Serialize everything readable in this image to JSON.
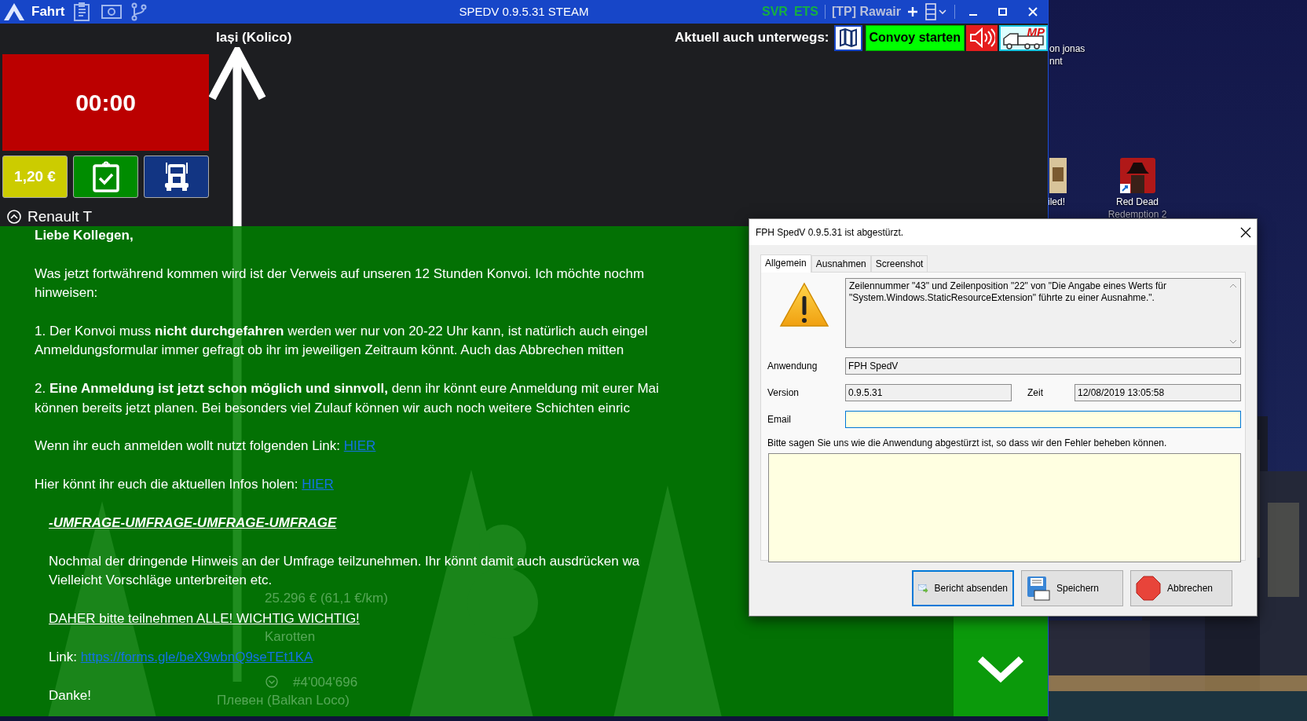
{
  "app": {
    "menu_label": "Fahrt",
    "title": "SPEDV 0.9.5.31 STEAM",
    "games": [
      {
        "text": "SVR",
        "active": true
      },
      {
        "text": "ETS",
        "active": true
      }
    ],
    "profile": "[TP] Rawair"
  },
  "route": {
    "from": "Iași (Kolico)",
    "to": "Плевен (Balkan Loco)"
  },
  "convoy": {
    "label": "Aktuell auch unterwegs:",
    "button": "Convoy starten",
    "mp_badge": "MP"
  },
  "timer": "00:00",
  "price": "1,20 €",
  "truck": "Renault T",
  "job": {
    "income": "25.296 € (61,1 €/km)",
    "cargo": "Karotten",
    "number": "#4'004'696"
  },
  "message": {
    "paragraphs": [
      {
        "kind": "greeting",
        "indented": false,
        "lines": [
          {
            "text": "Liebe Kollegen,"
          }
        ]
      },
      {
        "kind": "text",
        "indented": false,
        "lines": [
          {
            "text": "Was jetzt fortwährend kommen wird ist der Verweis auf unseren 12 Stunden Konvoi. Ich möchte nochm"
          },
          {
            "text": "hinweisen:"
          }
        ]
      },
      {
        "kind": "text",
        "indented": false,
        "lines": [
          {
            "text": "1. Der Konvoi muss **nicht durchgefahren** werden wer nur von 20-22 Uhr kann, ist natürlich auch eingel"
          },
          {
            "text": "Anmeldungsformular immer gefragt ob ihr im jeweiligen Zeitraum könnt. Auch das Abbrechen mitten"
          }
        ]
      },
      {
        "kind": "text",
        "indented": false,
        "lines": [
          {
            "text": "2. **Eine Anmeldung ist jetzt schon möglich und sinnvoll,** denn ihr könnt eure Anmeldung mit eurer Mai"
          },
          {
            "text": "können bereits jetzt planen. Bei besonders viel Zulauf können wir auch noch weitere Schichten einric"
          }
        ]
      },
      {
        "kind": "text",
        "indented": false,
        "lines": [
          {
            "text": "Wenn ihr euch anmelden wollt nutzt folgenden Link: ",
            "link": "HIER"
          }
        ]
      },
      {
        "kind": "text",
        "indented": false,
        "lines": [
          {
            "text": "Hier könnt ihr euch die aktuellen Infos holen: ",
            "link": "HIER"
          }
        ]
      },
      {
        "kind": "heading",
        "indented": true,
        "lines": [
          {
            "text": "-UMFRAGE-UMFRAGE-UMFRAGE-UMFRAGE"
          }
        ]
      },
      {
        "kind": "text",
        "indented": true,
        "lines": [
          {
            "text": "Nochmal der dringende Hinweis an der Umfrage teilzunehmen. Ihr könnt damit auch ausdrücken wa"
          },
          {
            "text": "Vielleicht Vorschläge unterbreiten etc."
          }
        ]
      },
      {
        "kind": "notice",
        "indented": true,
        "lines": [
          {
            "text": "DAHER bitte teilnehmen ALLE! WICHTIG WICHTIG!"
          }
        ]
      },
      {
        "kind": "text",
        "indented": true,
        "lines": [
          {
            "text": "Link: ",
            "link": "https://forms.gle/beX9wbnQ9seTEt1KA"
          }
        ]
      },
      {
        "kind": "text",
        "indented": true,
        "lines": [
          {
            "text": "Danke!"
          }
        ]
      }
    ]
  },
  "desktop_icons": [
    {
      "kind": "partial",
      "lines": [
        "on jonas",
        "nnt"
      ]
    },
    {
      "kind": "partial-tile",
      "lines": [
        "iled!"
      ]
    },
    {
      "kind": "game",
      "lines": [
        "Red Dead",
        "Redemption 2"
      ]
    }
  ],
  "dialog": {
    "title": "FPH SpedV 0.9.5.31 ist abgestürzt.",
    "tabs": [
      {
        "label": "Allgemein",
        "selected": true
      },
      {
        "label": "Ausnahmen",
        "selected": false
      },
      {
        "label": "Screenshot",
        "selected": false
      }
    ],
    "error_text": "Zeilennummer \"43\" und Zeilenposition \"22\" von \"Die Angabe eines Werts für \"System.Windows.StaticResourceExtension\" führte zu einer Ausnahme.\".",
    "application": {
      "label": "Anwendung",
      "value": "FPH SpedV"
    },
    "version": {
      "label": "Version",
      "value": "0.9.5.31"
    },
    "time": {
      "label": "Zeit",
      "value": "12/08/2019 13:05:58"
    },
    "email": {
      "label": "Email",
      "focused": true
    },
    "prompt": "Bitte sagen Sie uns wie die Anwendung abgestürzt ist, so dass wir den Fehler beheben können.",
    "buttons": [
      {
        "label": "Bericht absenden",
        "kind": "send",
        "focused": true
      },
      {
        "label": "Speichern",
        "kind": "save",
        "focused": false
      },
      {
        "label": "Abbrechen",
        "kind": "cancel",
        "focused": false
      }
    ]
  }
}
